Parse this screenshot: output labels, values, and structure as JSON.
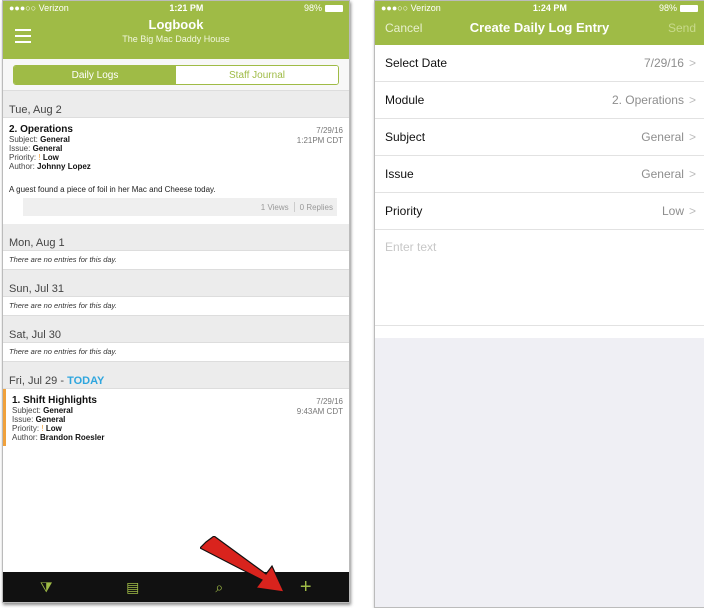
{
  "left": {
    "status": {
      "carrier": "●●●○○ Verizon",
      "time": "1:21 PM",
      "battery": "98%"
    },
    "header": {
      "title": "Logbook",
      "subtitle": "The Big Mac Daddy House"
    },
    "tabs": {
      "daily": "Daily Logs",
      "journal": "Staff Journal"
    },
    "days": [
      {
        "label": "Tue, Aug 2"
      },
      {
        "label": "Mon, Aug 1",
        "empty": "There are no entries for this day."
      },
      {
        "label": "Sun, Jul 31",
        "empty": "There are no entries for this day."
      },
      {
        "label": "Sat, Jul 30",
        "empty": "There are no entries for this day."
      },
      {
        "label": "Fri, Jul 29 - ",
        "today": "TODAY"
      }
    ],
    "entry1": {
      "title": "2. Operations",
      "subject_label": "Subject:",
      "subject": "General",
      "issue_label": "Issue:",
      "issue": "General",
      "priority_label": "Priority:",
      "priority_mark": "!",
      "priority": "Low",
      "author_label": "Author:",
      "author": "Johnny Lopez",
      "date": "7/29/16",
      "time": "1:21PM CDT",
      "body": "A guest found a piece of foil in her Mac and Cheese today.",
      "views": "1 Views",
      "replies": "0 Replies"
    },
    "entry2": {
      "title": "1. Shift Highlights",
      "subject_label": "Subject:",
      "subject": "General",
      "issue_label": "Issue:",
      "issue": "General",
      "priority_label": "Priority:",
      "priority_mark": "!",
      "priority": "Low",
      "author_label": "Author:",
      "author": "Brandon Roesler",
      "date": "7/29/16",
      "time": "9:43AM CDT"
    },
    "tabbar": {
      "filter": "⧩",
      "calendar": "▤",
      "search": "⌕",
      "add": "+"
    }
  },
  "right": {
    "status": {
      "carrier": "●●●○○ Verizon",
      "time": "1:24 PM",
      "battery": "98%"
    },
    "nav": {
      "cancel": "Cancel",
      "title": "Create Daily Log Entry",
      "send": "Send"
    },
    "rows": [
      {
        "label": "Select Date",
        "value": "7/29/16"
      },
      {
        "label": "Module",
        "value": "2. Operations"
      },
      {
        "label": "Subject",
        "value": "General"
      },
      {
        "label": "Issue",
        "value": "General"
      },
      {
        "label": "Priority",
        "value": "Low"
      }
    ],
    "placeholder": "Enter text"
  },
  "colors": {
    "brand_green": "#9fbb46",
    "today_blue": "#2fa6de",
    "arrow_red": "#d9231d",
    "highlight_orange": "#f0a13c"
  },
  "icons": [
    "menu-icon",
    "filter-icon",
    "calendar-icon",
    "search-icon",
    "add-icon",
    "chevron-right-icon",
    "red-arrow-icon"
  ]
}
